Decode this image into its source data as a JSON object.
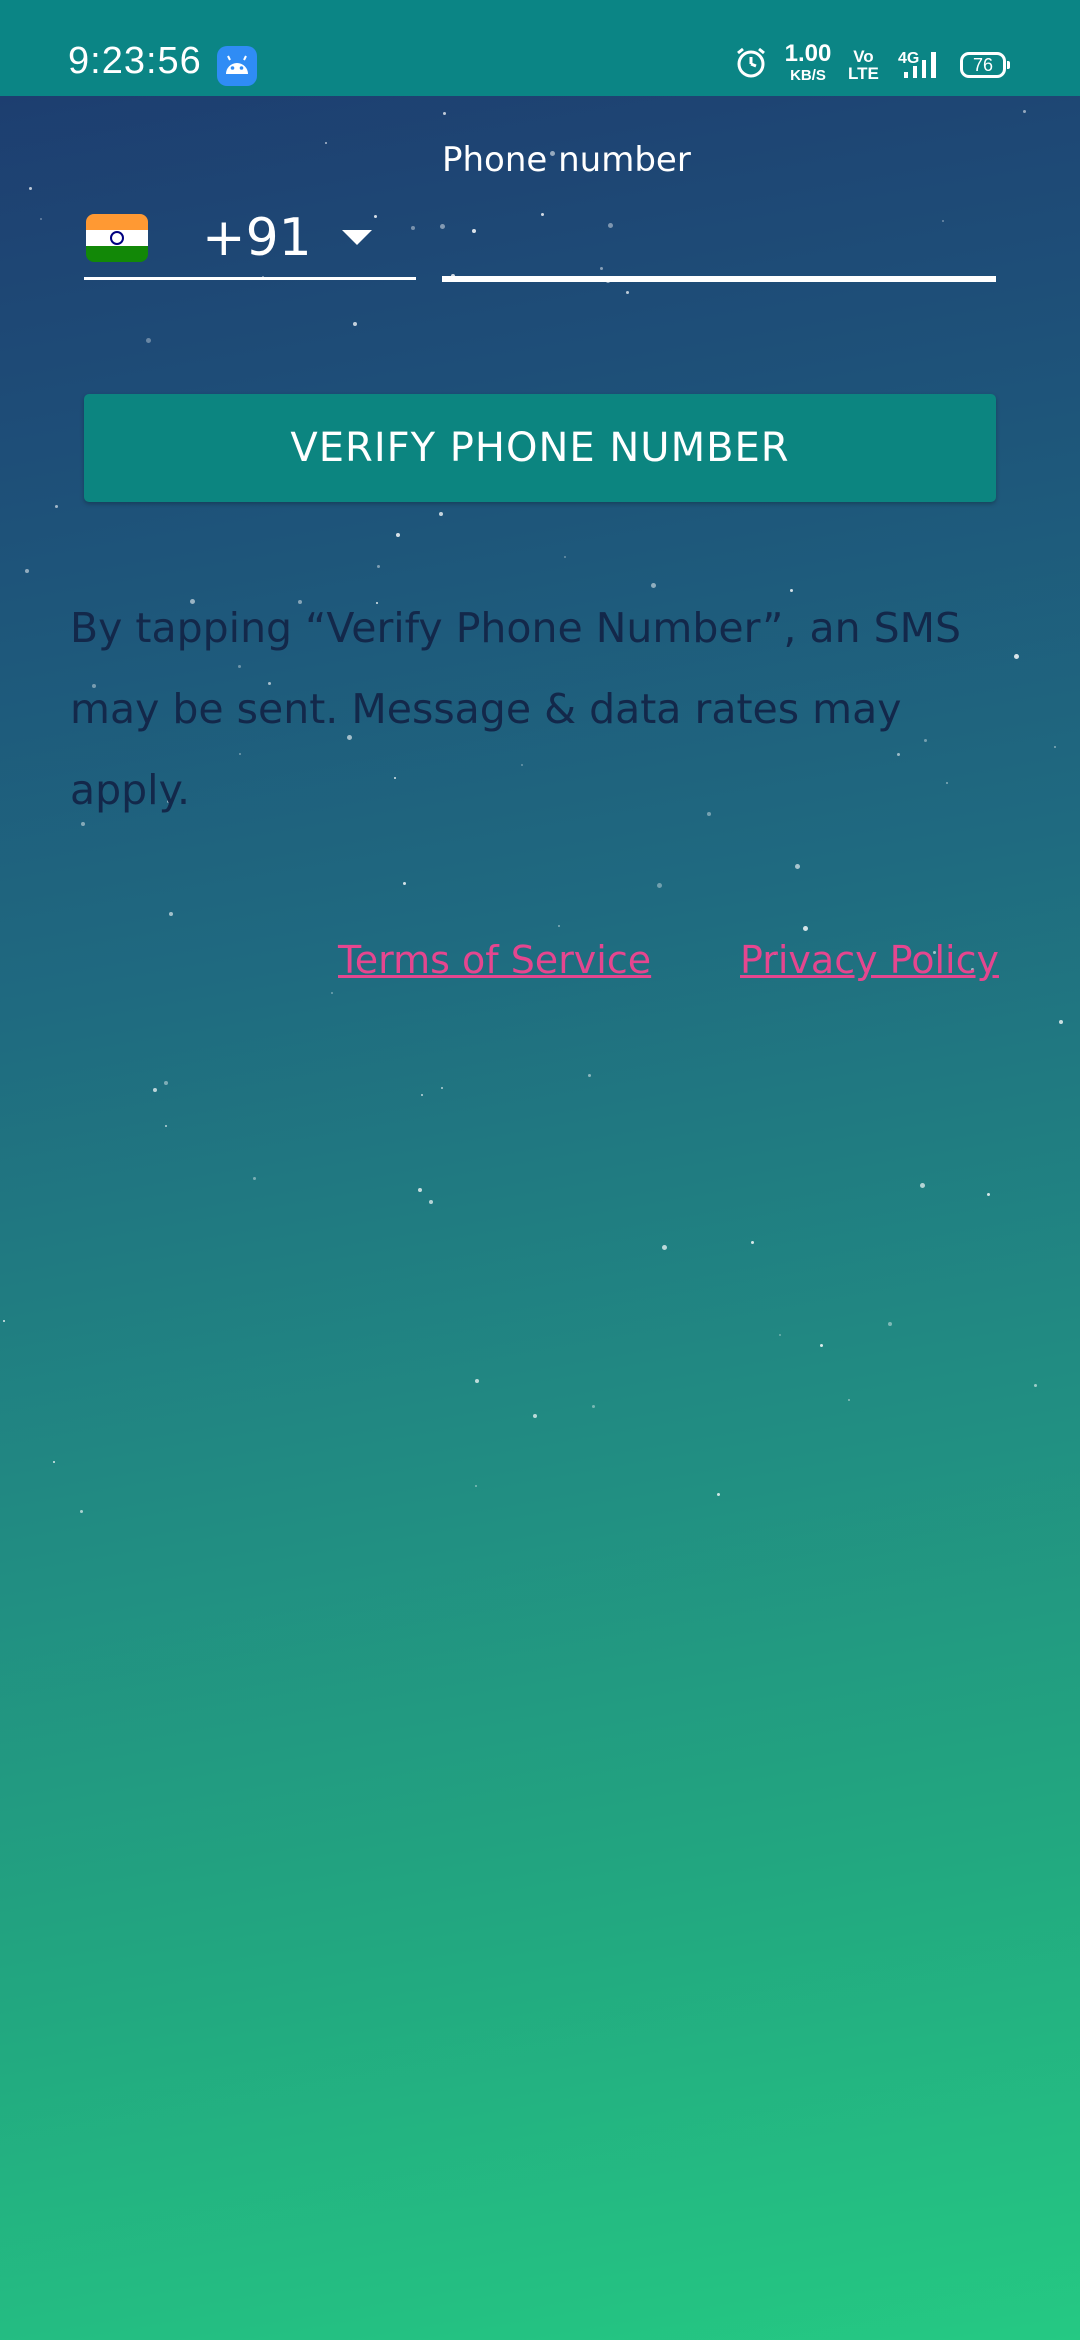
{
  "status_bar": {
    "time": "9:23:56",
    "net_speed_value": "1.00",
    "net_speed_unit": "KB/S",
    "volte_top": "Vo",
    "volte_bottom": "LTE",
    "network_type": "4G",
    "battery_level": "76",
    "icons": [
      "android-icon",
      "alarm-icon",
      "signal-icon",
      "battery-icon"
    ]
  },
  "form": {
    "phone_label": "Phone number",
    "country_flag": "india-flag-icon",
    "dial_code": "+91",
    "phone_value": "",
    "verify_button_label": "VERIFY PHONE NUMBER"
  },
  "disclaimer": "By tapping “Verify Phone Number”, an SMS may be sent. Message & data rates may apply.",
  "links": {
    "terms": "Terms of Service",
    "privacy": "Privacy Policy"
  },
  "colors": {
    "status_bar": "#0b8585",
    "button": "#0c8580",
    "link": "#e5468f",
    "disclaimer_text": "#13284a",
    "gradient_top": "#1d3a6e",
    "gradient_bottom": "#25c983"
  }
}
